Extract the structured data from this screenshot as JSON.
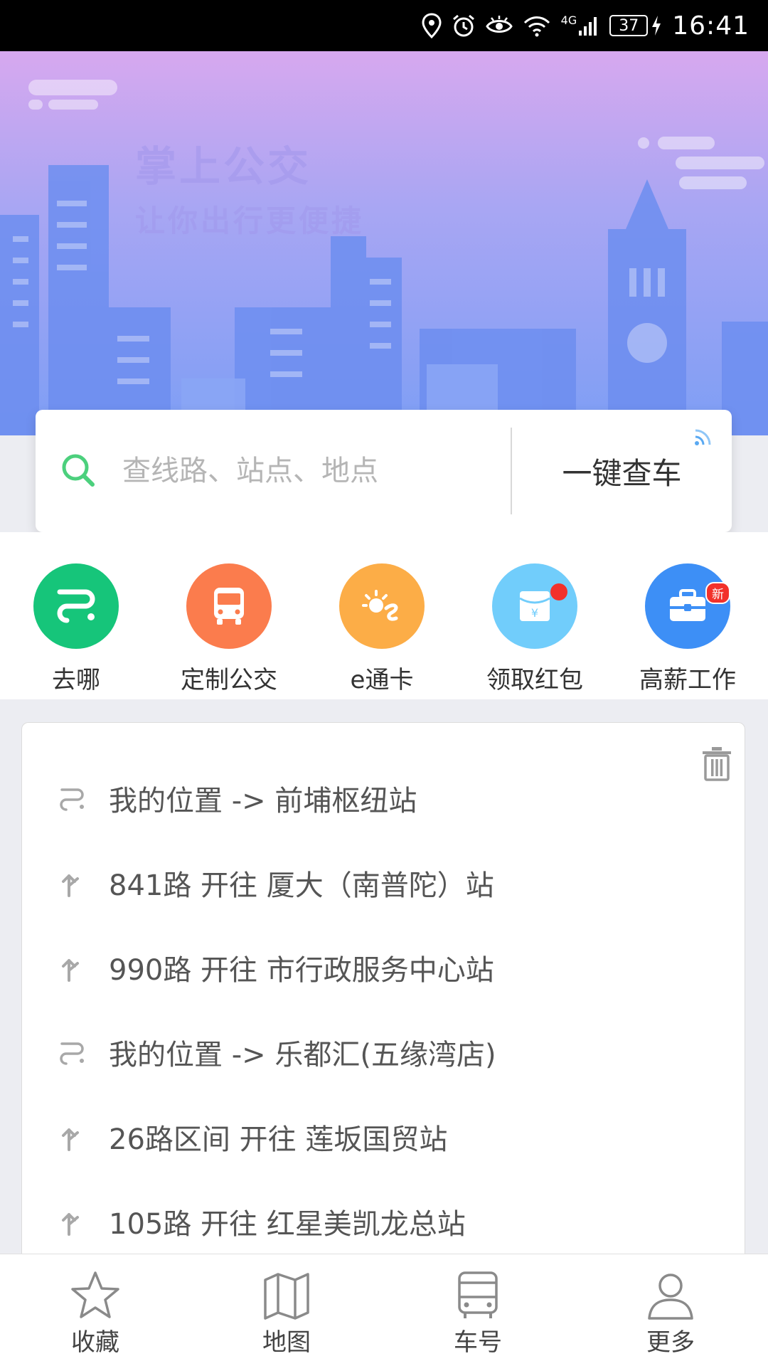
{
  "status_bar": {
    "battery": "37",
    "time": "16:41",
    "network": "4G",
    "icons": [
      "location-icon",
      "alarm-icon",
      "eye-icon",
      "wifi-icon",
      "signal-icon",
      "battery-icon",
      "charging-icon"
    ]
  },
  "hero": {
    "title": "掌上公交",
    "subtitle": "让你出行更便捷"
  },
  "search": {
    "placeholder": "查线路、站点、地点",
    "value": "",
    "onekey_label": "一键查车"
  },
  "quick_actions": [
    {
      "label": "去哪",
      "icon": "route-icon",
      "color": "#16c57a"
    },
    {
      "label": "定制公交",
      "icon": "bus-icon",
      "color": "#fb7c4d"
    },
    {
      "label": "e通卡",
      "icon": "ecard-icon",
      "color": "#fcad47"
    },
    {
      "label": "领取红包",
      "icon": "red-packet-icon",
      "color": "#71cdfb",
      "badge_dot": true
    },
    {
      "label": "高薪工作",
      "icon": "briefcase-icon",
      "color": "#3d8ff6",
      "badge": "新"
    }
  ],
  "history": [
    {
      "type": "route",
      "icon": "route-icon",
      "text": "我的位置 -> 前埔枢纽站"
    },
    {
      "type": "line",
      "icon": "direction-icon",
      "text": "841路 开往 厦大（南普陀）站"
    },
    {
      "type": "line",
      "icon": "direction-icon",
      "text": "990路 开往 市行政服务中心站"
    },
    {
      "type": "route",
      "icon": "route-icon",
      "text": "我的位置 -> 乐都汇(五缘湾店)"
    },
    {
      "type": "line",
      "icon": "direction-icon",
      "text": "26路区间 开往 莲坂国贸站"
    },
    {
      "type": "line",
      "icon": "direction-icon",
      "text": "105路 开往 红星美凯龙总站"
    }
  ],
  "bottom_nav": [
    {
      "label": "收藏",
      "icon": "star-icon"
    },
    {
      "label": "地图",
      "icon": "map-icon"
    },
    {
      "label": "车号",
      "icon": "bus-front-icon"
    },
    {
      "label": "更多",
      "icon": "user-icon"
    }
  ],
  "colors": {
    "search_icon": "#4cd07d",
    "hero_top": "#d7a8ef",
    "hero_bottom": "#7d9ef5",
    "badge_red": "#f2312b"
  }
}
